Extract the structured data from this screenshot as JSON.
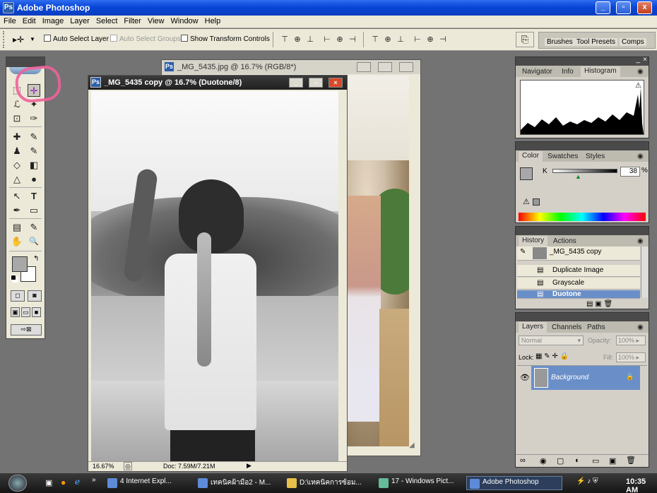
{
  "app": {
    "title": "Adobe Photoshop"
  },
  "window_controls": {
    "min": "_",
    "max": "▫",
    "close": "x"
  },
  "menu": [
    "File",
    "Edit",
    "Image",
    "Layer",
    "Select",
    "Filter",
    "View",
    "Window",
    "Help"
  ],
  "options": {
    "tool_glyph": "▸✛",
    "auto_select_layer": "Auto Select Layer",
    "auto_select_groups": "Auto Select Groups",
    "show_transform": "Show Transform Controls",
    "align_icons": [
      "⊤",
      "⊕",
      "⊥",
      "⊢",
      "⊕",
      "⊣"
    ],
    "distribute_icons": [
      "⊤",
      "⊕",
      "⊥",
      "⊢",
      "⊕",
      "⊣"
    ],
    "well_tabs": [
      "Brushes",
      "Tool Presets",
      "Comps"
    ]
  },
  "toolbox": {
    "tools": [
      "⬚",
      "✛",
      "ℒ",
      "✦",
      "⊡",
      "✑",
      "✚",
      "✎",
      "♟",
      "✎",
      "◇",
      "◧",
      "△",
      "●",
      "↖",
      "T",
      "✒",
      "▭",
      "▤",
      "✎",
      "✋",
      "🔍"
    ],
    "fg_color": "#a8a8a8",
    "bg_color": "#ffffff"
  },
  "doc_back": {
    "title": "_MG_5435.jpg @ 16.7% (RGB/8*)"
  },
  "doc_front": {
    "title": "_MG_5435 copy @ 16.7% (Duotone/8)",
    "zoom": "16.67%",
    "doc_info": "Doc: 7.59M/7.21M"
  },
  "navigator": {
    "tabs": [
      "Navigator",
      "Info",
      "Histogram"
    ]
  },
  "color": {
    "tabs": [
      "Color",
      "Swatches",
      "Styles"
    ],
    "channel": "K",
    "value": "38",
    "unit": "%",
    "warning": "⚠"
  },
  "history": {
    "tabs": [
      "History",
      "Actions"
    ],
    "snapshot": "_MG_5435 copy",
    "items": [
      "Duplicate Image",
      "Grayscale",
      "Duotone"
    ]
  },
  "layers": {
    "tabs": [
      "Layers",
      "Channels",
      "Paths"
    ],
    "blend_mode": "Normal",
    "opacity_label": "Opacity:",
    "opacity": "100%",
    "lock_label": "Lock:",
    "fill_label": "Fill:",
    "fill": "100%",
    "layer_name": "Background",
    "bottom_icons": [
      "∞",
      "◉",
      "▢",
      "◐",
      "▭",
      "▣",
      "🗑"
    ]
  },
  "taskbar": {
    "tasks": [
      "4 Internet Expl...",
      "เทคนิคฝ้ามือ2 - M...",
      "D:\\เทคนิคการซ้อม...",
      "17 - Windows Pict...",
      "Adobe Photoshop"
    ],
    "clock": "10:35 AM"
  },
  "colors": {
    "selection": "#6a8fc8",
    "titlebar": "#0a46d8"
  }
}
